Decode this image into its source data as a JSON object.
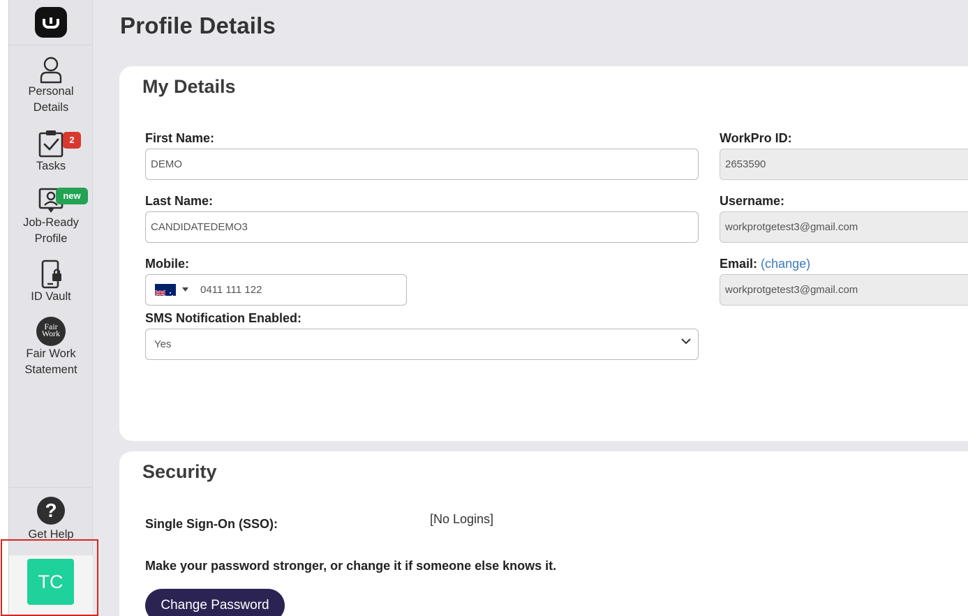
{
  "page": {
    "title": "Profile Details"
  },
  "sidebar": {
    "items": [
      {
        "label_line1": "Personal",
        "label_line2": "Details"
      },
      {
        "label_line1": "Tasks",
        "badge": "2"
      },
      {
        "label_line1": "Job-Ready",
        "label_line2": "Profile",
        "badge": "new"
      },
      {
        "label_line1": "ID Vault"
      },
      {
        "label_line1": "Fair Work",
        "label_line2": "Statement",
        "logo_text1": "Fair",
        "logo_text2": "Work"
      },
      {
        "label_line1": "Get Help"
      }
    ],
    "avatar_initials": "TC"
  },
  "details": {
    "title": "My Details",
    "first_name": {
      "label": "First Name:",
      "value": "DEMO"
    },
    "last_name": {
      "label": "Last Name:",
      "value": "CANDIDATEDEMO3"
    },
    "mobile": {
      "label": "Mobile:",
      "value": "0411 111 122",
      "country": "AU"
    },
    "sms": {
      "label": "SMS Notification Enabled:",
      "value": "Yes"
    },
    "workpro_id": {
      "label": "WorkPro ID:",
      "value": "2653590"
    },
    "username": {
      "label": "Username:",
      "value": "workprotgetest3@gmail.com"
    },
    "email": {
      "label": "Email:",
      "change_link": "(change)",
      "value": "workprotgetest3@gmail.com"
    }
  },
  "security": {
    "title": "Security",
    "sso_label": "Single Sign-On (SSO):",
    "sso_value": "[No Logins]",
    "password_hint": "Make your password stronger, or change it if someone else knows it.",
    "change_password_label": "Change Password"
  },
  "colors": {
    "accent_navy": "#2b2452",
    "avatar_green": "#1fd19a",
    "badge_red": "#d9382e",
    "badge_green": "#21a351",
    "link_blue": "#3a7bbf",
    "highlight_red": "#d8261f"
  }
}
